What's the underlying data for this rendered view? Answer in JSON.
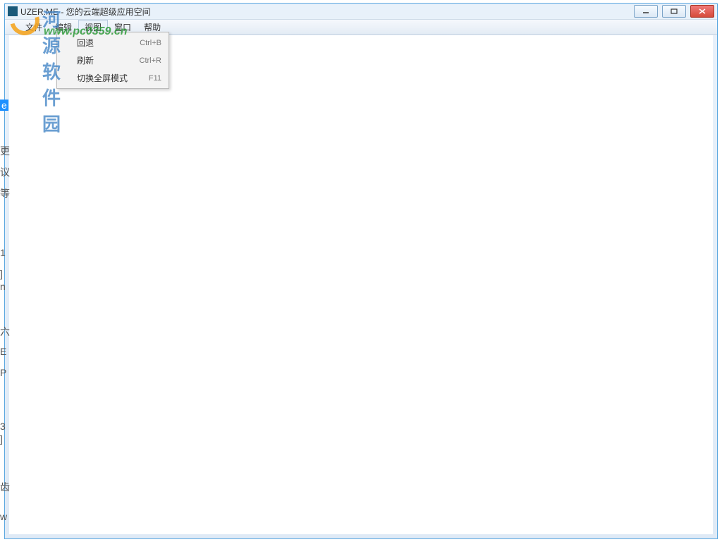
{
  "window": {
    "title": "UZER.ME - 您的云端超级应用空间"
  },
  "menubar": {
    "items": [
      {
        "label": "文件"
      },
      {
        "label": "编辑"
      },
      {
        "label": "视图"
      },
      {
        "label": "窗口"
      },
      {
        "label": "帮助"
      }
    ]
  },
  "dropdown": {
    "items": [
      {
        "label": "回退",
        "shortcut": "Ctrl+B"
      },
      {
        "label": "刷新",
        "shortcut": "Ctrl+R"
      },
      {
        "label": "切换全屏模式",
        "shortcut": "F11"
      }
    ]
  },
  "watermark": {
    "cn": "河源软件园",
    "url": "www.pc0359.cn"
  },
  "left_fragments": [
    "e",
    "更",
    "议",
    "等",
    "1",
    "]",
    "n",
    "六",
    "E",
    "P",
    "3",
    "]",
    "齿",
    "w"
  ]
}
